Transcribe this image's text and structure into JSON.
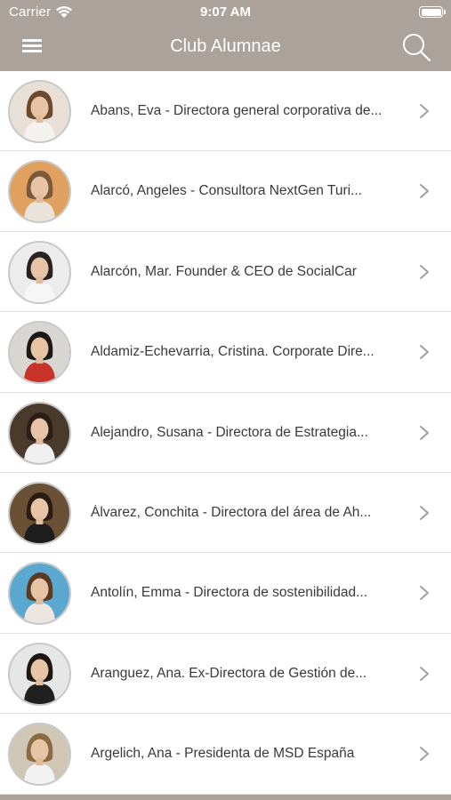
{
  "status_bar": {
    "carrier": "Carrier",
    "time": "9:07 AM",
    "wifi_icon": "wifi-icon",
    "battery_icon": "battery-icon"
  },
  "nav": {
    "title": "Club Alumnae",
    "menu_icon": "hamburger-menu-icon",
    "search_icon": "search-icon"
  },
  "colors": {
    "bar": "#aba39b",
    "text": "#3a3a3a",
    "chevron": "#a0a0a0",
    "divider": "#e4e4e4"
  },
  "contacts": [
    {
      "label": "Abans, Eva - Directora general corporativa de...",
      "bg": "#e8e0d6",
      "hair": "#6b4a2e",
      "top": "#f4f1ee"
    },
    {
      "label": "Alarcó,  Angeles  - Consultora NextGen Turi...",
      "bg": "#e0a060",
      "hair": "#7a5a3a",
      "top": "#e9e3dc"
    },
    {
      "label": "Alarcón, Mar. Founder & CEO  de SocialCar",
      "bg": "#ececec",
      "hair": "#2a2220",
      "top": "#f6f6f6"
    },
    {
      "label": "Aldamiz-Echevarria, Cristina. Corporate Dire...",
      "bg": "#d8d6d2",
      "hair": "#1c1816",
      "top": "#c8342a"
    },
    {
      "label": "Alejandro, Susana -  Directora de Estrategia...",
      "bg": "#4a3a2c",
      "hair": "#2a1e16",
      "top": "#f0f0f0"
    },
    {
      "label": "Álvarez, Conchita - Directora del área de Ah...",
      "bg": "#6a5034",
      "hair": "#2a1c12",
      "top": "#1e1e1e"
    },
    {
      "label": "Antolín, Emma - Directora de sostenibilidad...",
      "bg": "#5aa8d0",
      "hair": "#5a3a22",
      "top": "#ece6de"
    },
    {
      "label": "Aranguez, Ana. Ex-Directora de Gestión de...",
      "bg": "#e6e6e6",
      "hair": "#1e1612",
      "top": "#202020"
    },
    {
      "label": "Argelich, Ana - Presidenta de MSD España",
      "bg": "#cfc6b6",
      "hair": "#8a6a40",
      "top": "#f2f2f2"
    }
  ]
}
